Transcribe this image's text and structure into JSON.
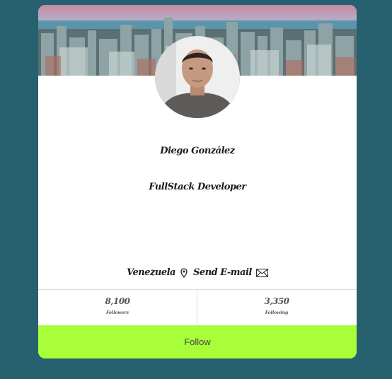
{
  "profile": {
    "name": "Diego González",
    "role": "FullStack Developer",
    "location": "Venezuela",
    "email_link": "Send E-mail"
  },
  "stats": {
    "followers": {
      "value": "8,100",
      "label": "Followers"
    },
    "following": {
      "value": "3,350",
      "label": "Following"
    }
  },
  "actions": {
    "follow_label": "Follow"
  },
  "icons": {
    "location": "map-pin-icon",
    "email": "envelope-icon"
  },
  "colors": {
    "page_background": "#27606e",
    "card_background": "#ffffff",
    "follow_button": "#a8fe39"
  }
}
